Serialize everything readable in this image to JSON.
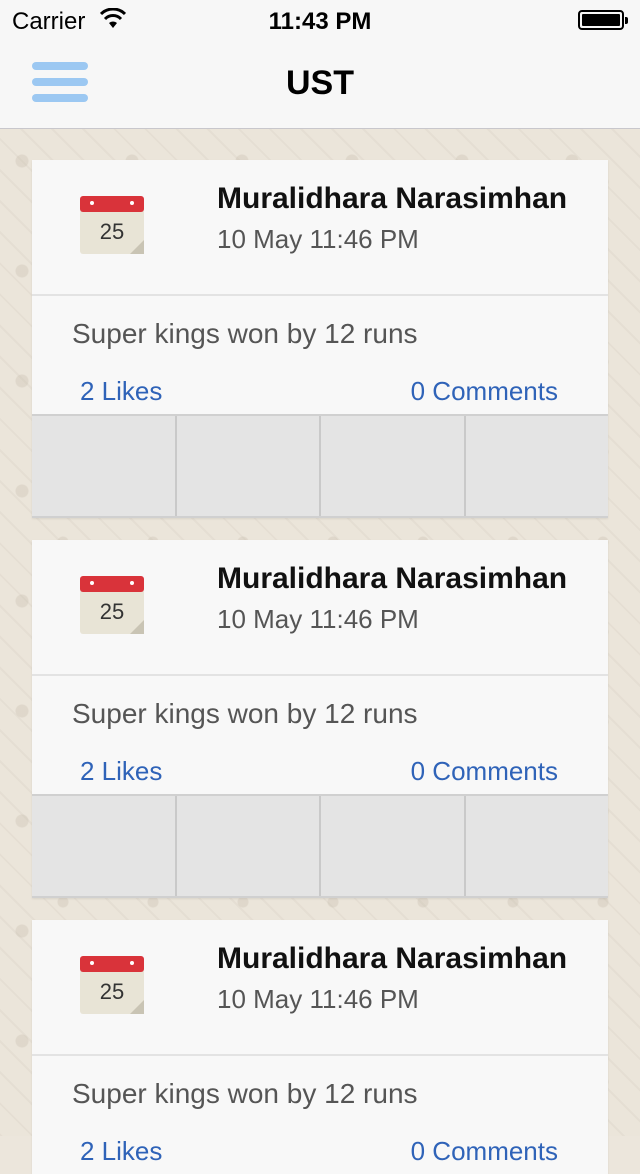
{
  "status_bar": {
    "carrier": "Carrier",
    "time": "11:43 PM"
  },
  "nav": {
    "title": "UST",
    "menu_icon": "hamburger-menu-icon"
  },
  "posts": [
    {
      "name": "Muralidhara Narasimhan",
      "date": "10 May 11:46 PM",
      "text": "Super kings won by 12 runs",
      "likes": "2 Likes",
      "comments": "0 Comments",
      "calendar_day": "25"
    },
    {
      "name": "Muralidhara Narasimhan",
      "date": "10 May 11:46 PM",
      "text": "Super kings won by 12 runs",
      "likes": "2 Likes",
      "comments": "0 Comments",
      "calendar_day": "25"
    },
    {
      "name": "Muralidhara Narasimhan",
      "date": "10 May 11:46 PM",
      "text": "Super kings won by 12 runs",
      "likes": "2 Likes",
      "comments": "0 Comments",
      "calendar_day": "25"
    }
  ],
  "colors": {
    "link": "#2f63b8",
    "menu_icon": "#9cc8f2",
    "calendar_red": "#d9333a"
  }
}
